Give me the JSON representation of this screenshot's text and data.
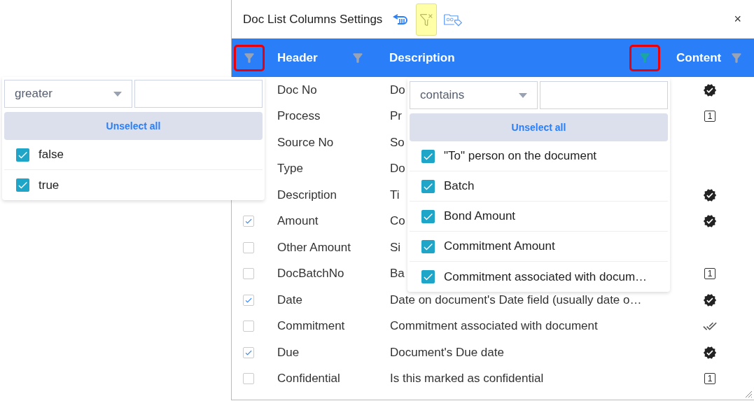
{
  "dialog": {
    "title": "Doc List Columns Settings",
    "close": "×",
    "toolbar": [
      {
        "kind": "reset",
        "highlighted": false
      },
      {
        "kind": "clear-filter",
        "highlighted": true
      },
      {
        "kind": "tags",
        "highlighted": false
      }
    ]
  },
  "columns": [
    {
      "kind": "select",
      "filter_active": false,
      "highlighted": true,
      "popup": {
        "operator": "greater",
        "button": "Unselect all",
        "options": [
          {
            "label": "false",
            "checked": true
          },
          {
            "label": "true",
            "checked": true
          }
        ]
      }
    },
    {
      "kind": "text",
      "label": "Header",
      "filter_active": false,
      "highlighted": false
    },
    {
      "kind": "text",
      "label": "Description",
      "filter_active": true,
      "highlighted": true,
      "popup": {
        "operator": "contains",
        "button": "Unselect all",
        "options": [
          {
            "label": "\"To\" person on the document",
            "checked": true
          },
          {
            "label": "Batch",
            "checked": true
          },
          {
            "label": "Bond Amount",
            "checked": true
          },
          {
            "label": "Commitment Amount",
            "checked": true
          },
          {
            "label": "Commitment associated with docum…",
            "checked": true
          }
        ]
      }
    },
    {
      "kind": "text",
      "label": "Content",
      "filter_active": false,
      "highlighted": false
    }
  ],
  "rows": [
    {
      "header": "Doc No",
      "description": "Do",
      "content": {
        "kind": "verified"
      }
    },
    {
      "header": "Process",
      "description": "Pr",
      "content": {
        "kind": "number",
        "text": "1"
      }
    },
    {
      "header": "Source No",
      "description": "So"
    },
    {
      "header": "Type",
      "description": "Do"
    },
    {
      "header": "Description",
      "description": "Ti",
      "content": {
        "kind": "verified"
      }
    },
    {
      "checked": true,
      "header": "Amount",
      "description": "Co",
      "content": {
        "kind": "verified"
      }
    },
    {
      "checked": false,
      "header": "Other Amount",
      "description": "Si"
    },
    {
      "checked": false,
      "header": "DocBatchNo",
      "description": "Ba",
      "content": {
        "kind": "number",
        "text": "1"
      }
    },
    {
      "checked": true,
      "header": "Date",
      "description": "Date on document's Date field (usually date o…",
      "content": {
        "kind": "verified"
      }
    },
    {
      "checked": false,
      "header": "Commitment",
      "description": "Commitment associated with document",
      "content": {
        "kind": "double-check"
      }
    },
    {
      "checked": true,
      "header": "Due",
      "description": "Document's Due date",
      "content": {
        "kind": "verified"
      }
    },
    {
      "checked": false,
      "header": "Confidential",
      "description": "Is this marked as confidential",
      "content": {
        "kind": "number",
        "text": "1"
      }
    }
  ]
}
